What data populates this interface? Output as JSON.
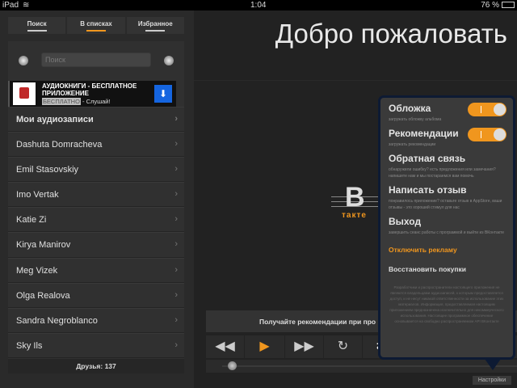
{
  "status": {
    "device": "iPad",
    "time": "1:04",
    "battery": "76 %"
  },
  "tabs": [
    {
      "label": "Поиск"
    },
    {
      "label": "В списках"
    },
    {
      "label": "Избранное"
    }
  ],
  "search": {
    "placeholder": "Поиск"
  },
  "ad": {
    "title": "АУДИОКНИГИ - БЕСПЛАТНОЕ ПРИЛОЖЕНИЕ",
    "free": "БЕСПЛАТНО",
    "tagline": " - Слушай!"
  },
  "list": [
    "Мои аудиозаписи",
    "Dashuta Domracheva",
    "Emil Stasovskiy",
    "Imo Vertak",
    "Katie Zi",
    "Kirya Manirov",
    "Meg Vizek",
    "Olga Realova",
    "Sandra Negroblanco",
    "Sky Ils"
  ],
  "footer": "Друзья: 137",
  "main": {
    "title": "Добро пожаловать",
    "logo_text": "B",
    "logo_sub": "такте",
    "banner": "Получайте рекомендации при про"
  },
  "settings": {
    "cover": {
      "title": "Обложка",
      "desc": "загружать обложку альбома",
      "on": true
    },
    "recs": {
      "title": "Рекомендации",
      "desc": "загружать рекомендации",
      "on": true
    },
    "feedback": {
      "title": "Обратная связь",
      "desc": "обнаружили ошибку? есть предложения или замечания? напишите нам и мы постараемся вам помочь"
    },
    "review": {
      "title": "Написать отзыв",
      "desc": "понравилось приложение? оставьте отзыв в AppStore, ваши отзывы - это хороший стимул для нас"
    },
    "logout": {
      "title": "Выход",
      "desc": "завершить сеанс работы с программой и выйти из ВКонтакте"
    },
    "disable_ads": "Отключить рекламу",
    "restore": "Восстановить покупки",
    "disclaimer": "Разработчики и распространители настоящего приложения не являются владельцами аудиозаписей, к которым предоставляется доступ, и не несут никакой ответственности за использование этих материалов. Информация, предоставляемая настоящим приложением предназначена исключительно для некоммерческого использования. Настоящее программное обеспечение основывается на свободно распространяемом API ВКонтакте",
    "accent": "#f0961e"
  },
  "settings_button": "Настройки"
}
